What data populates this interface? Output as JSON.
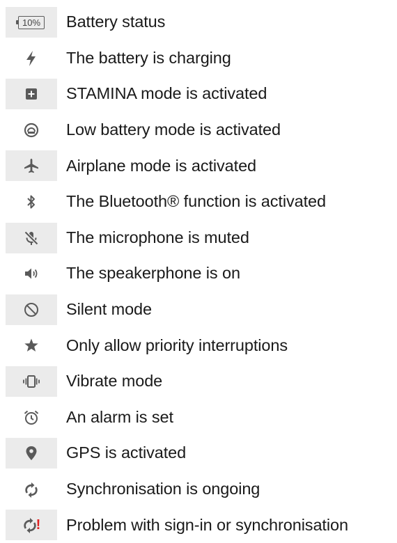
{
  "rows": [
    {
      "icon": "battery-status-icon",
      "icon_text": "10%",
      "label": "Battery status"
    },
    {
      "icon": "charging-bolt-icon",
      "label": "The battery is charging"
    },
    {
      "icon": "stamina-plus-icon",
      "label": "STAMINA mode is activated"
    },
    {
      "icon": "low-battery-gauge-icon",
      "label": "Low battery mode is activated"
    },
    {
      "icon": "airplane-icon",
      "label": "Airplane mode is activated"
    },
    {
      "icon": "bluetooth-icon",
      "label": "The Bluetooth® function is activated"
    },
    {
      "icon": "microphone-muted-icon",
      "label": "The microphone is muted"
    },
    {
      "icon": "speakerphone-icon",
      "label": "The speakerphone is on"
    },
    {
      "icon": "silent-mode-icon",
      "label": "Silent mode"
    },
    {
      "icon": "star-icon",
      "label": "Only allow priority interruptions"
    },
    {
      "icon": "vibrate-icon",
      "label": "Vibrate mode"
    },
    {
      "icon": "alarm-clock-icon",
      "label": "An alarm is set"
    },
    {
      "icon": "gps-pin-icon",
      "label": "GPS is activated"
    },
    {
      "icon": "sync-icon",
      "label": "Synchronisation is ongoing"
    },
    {
      "icon": "sync-problem-icon",
      "icon_text": "!",
      "label": "Problem with sign-in or synchronisation"
    }
  ],
  "colors": {
    "icon": "#5a5a5a",
    "shade": "#ebebeb",
    "warning": "#e02020",
    "text": "#1a1a1a"
  }
}
